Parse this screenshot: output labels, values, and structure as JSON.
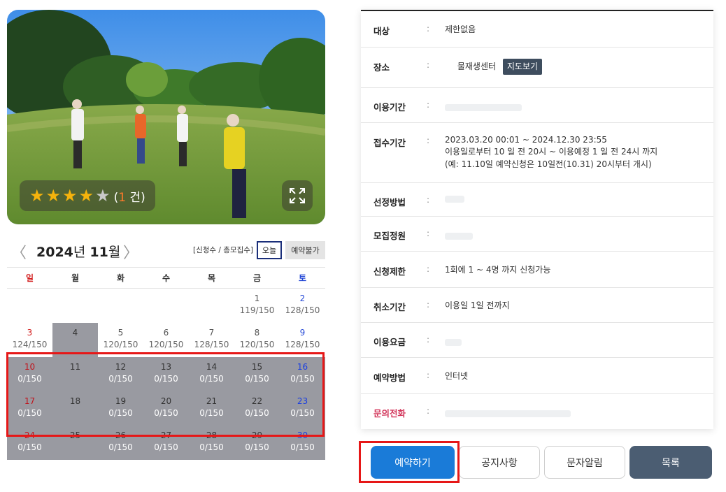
{
  "photo": {
    "rating": {
      "stars_filled": 4,
      "stars_total": 5,
      "count_prefix": "(",
      "count": "1",
      "count_suffix": " 건)"
    }
  },
  "calendar": {
    "year": "2024",
    "year_suffix": "년 ",
    "month": "11",
    "month_suffix": "월",
    "legend": "[신청수 / 총모집수]",
    "today_label": "오늘",
    "unavailable_label": "예약불가",
    "weekdays": [
      "일",
      "월",
      "화",
      "수",
      "목",
      "금",
      "토"
    ],
    "weeks": [
      [
        {
          "day": "",
          "count": ""
        },
        {
          "day": "",
          "count": ""
        },
        {
          "day": "",
          "count": ""
        },
        {
          "day": "",
          "count": ""
        },
        {
          "day": "",
          "count": ""
        },
        {
          "day": "1",
          "count": "119/150"
        },
        {
          "day": "2",
          "count": "128/150"
        }
      ],
      [
        {
          "day": "3",
          "count": "124/150"
        },
        {
          "day": "4",
          "count": ""
        },
        {
          "day": "5",
          "count": "120/150"
        },
        {
          "day": "6",
          "count": "120/150"
        },
        {
          "day": "7",
          "count": "128/150"
        },
        {
          "day": "8",
          "count": "120/150"
        },
        {
          "day": "9",
          "count": "128/150"
        }
      ],
      [
        {
          "day": "10",
          "count": "0/150"
        },
        {
          "day": "11",
          "count": ""
        },
        {
          "day": "12",
          "count": "0/150"
        },
        {
          "day": "13",
          "count": "0/150"
        },
        {
          "day": "14",
          "count": "0/150"
        },
        {
          "day": "15",
          "count": "0/150"
        },
        {
          "day": "16",
          "count": "0/150"
        }
      ],
      [
        {
          "day": "17",
          "count": "0/150"
        },
        {
          "day": "18",
          "count": ""
        },
        {
          "day": "19",
          "count": "0/150"
        },
        {
          "day": "20",
          "count": "0/150"
        },
        {
          "day": "21",
          "count": "0/150"
        },
        {
          "day": "22",
          "count": "0/150"
        },
        {
          "day": "23",
          "count": "0/150"
        }
      ],
      [
        {
          "day": "24",
          "count": "0/150"
        },
        {
          "day": "25",
          "count": ""
        },
        {
          "day": "26",
          "count": "0/150"
        },
        {
          "day": "27",
          "count": "0/150"
        },
        {
          "day": "28",
          "count": "0/150"
        },
        {
          "day": "29",
          "count": "0/150"
        },
        {
          "day": "30",
          "count": "0/150"
        }
      ]
    ]
  },
  "info": {
    "target_label": "대상",
    "target_value": "제한없음",
    "place_label": "장소",
    "place_value": "물재생센터",
    "map_button": "지도보기",
    "use_period_label": "이용기간",
    "apply_period_label": "접수기간",
    "apply_period_lines": [
      "2023.03.20 00:01 ~ 2024.12.30 23:55",
      "이용일로부터 10 일 전 20시 ~ 이용예정 1 일 전 24시 까지",
      "(예: 11.10일 예약신청은 10일전(10.31) 20시부터 개시)"
    ],
    "selection_label": "선정방법",
    "capacity_label": "모집정원",
    "limit_label": "신청제한",
    "limit_value": "1회에 1 ~ 4명 까지 신청가능",
    "cancel_label": "취소기간",
    "cancel_value": "이용일 1일 전까지",
    "fee_label": "이용요금",
    "method_label": "예약방법",
    "method_value": "인터넷",
    "phone_label": "문의전화",
    "colon": ":"
  },
  "buttons": {
    "reserve": "예약하기",
    "notice": "공지사항",
    "sms": "문자알림",
    "list": "목록"
  },
  "colors": {
    "accent_blue": "#1a7bd8",
    "dark_slate": "#4b5d72",
    "highlight_red": "#e61717",
    "star": "#f5b30c",
    "closed_cell": "#999aa1"
  }
}
